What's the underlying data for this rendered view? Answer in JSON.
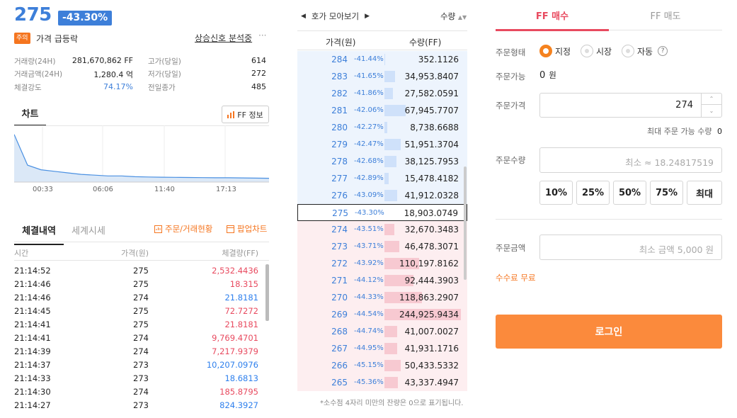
{
  "header": {
    "price": "275",
    "change": "-43.30%",
    "warn_badge": "주의",
    "warn_text": "가격 급등락",
    "analysis_link": "상승신호 분석중",
    "analysis_more": "···"
  },
  "stats": {
    "left": [
      {
        "label": "거래량(24H)",
        "value": "281,670,862 FF"
      },
      {
        "label": "거래금액(24H)",
        "value": "1,280.4 억"
      },
      {
        "label": "체결강도",
        "value": "74.17%"
      }
    ],
    "right": [
      {
        "label": "고가(당일)",
        "value": "614"
      },
      {
        "label": "저가(당일)",
        "value": "272"
      },
      {
        "label": "전일종가",
        "value": "485"
      }
    ]
  },
  "chart": {
    "tab": "차트",
    "info_button": "FF 정보",
    "time_labels": [
      "00:33",
      "06:06",
      "11:40",
      "17:13"
    ]
  },
  "chart_data": {
    "type": "area",
    "title": "",
    "xlabel": "",
    "ylabel": "",
    "x": [
      "00:33",
      "06:06",
      "11:40",
      "17:13"
    ],
    "values": [
      560,
      360,
      330,
      320,
      310,
      300,
      295,
      290,
      290,
      285,
      283,
      282,
      281,
      280,
      279,
      278,
      278,
      277,
      276,
      275
    ],
    "color": "#4a90e2"
  },
  "trades": {
    "tab_active": "체결내역",
    "tab_other": "세계시세",
    "link_orders": "주문/거래현황",
    "link_popup": "팝업차트",
    "columns": [
      "시간",
      "가격(원)",
      "체결량(FF)"
    ],
    "rows": [
      {
        "time": "21:14:52",
        "price": "275",
        "qty": "2,532.4436",
        "side": "buy"
      },
      {
        "time": "21:14:46",
        "price": "275",
        "qty": "18.315",
        "side": "buy"
      },
      {
        "time": "21:14:46",
        "price": "274",
        "qty": "21.8181",
        "side": "sell"
      },
      {
        "time": "21:14:45",
        "price": "275",
        "qty": "72.7272",
        "side": "buy"
      },
      {
        "time": "21:14:41",
        "price": "275",
        "qty": "21.8181",
        "side": "buy"
      },
      {
        "time": "21:14:41",
        "price": "274",
        "qty": "9,769.4701",
        "side": "buy"
      },
      {
        "time": "21:14:39",
        "price": "274",
        "qty": "7,217.9379",
        "side": "buy"
      },
      {
        "time": "21:14:37",
        "price": "273",
        "qty": "10,207.0976",
        "side": "sell"
      },
      {
        "time": "21:14:33",
        "price": "273",
        "qty": "18.6813",
        "side": "sell"
      },
      {
        "time": "21:14:30",
        "price": "274",
        "qty": "185.8795",
        "side": "buy"
      },
      {
        "time": "21:14:27",
        "price": "273",
        "qty": "824.3927",
        "side": "sell"
      }
    ]
  },
  "orderbook": {
    "top_left": "호가 모아보기",
    "top_right": "수량",
    "col_price": "가격(원)",
    "col_qty": "수량(FF)",
    "footnote": "*소수점 4자리 미만의 잔량은 0으로 표기됩니다.",
    "rows": [
      {
        "price": "284",
        "pct": "-41.44%",
        "qty": "352.1126",
        "side": "ask",
        "ratio": 0.01
      },
      {
        "price": "283",
        "pct": "-41.65%",
        "qty": "34,953.8407",
        "side": "ask",
        "ratio": 0.14
      },
      {
        "price": "282",
        "pct": "-41.86%",
        "qty": "27,582.0591",
        "side": "ask",
        "ratio": 0.11
      },
      {
        "price": "281",
        "pct": "-42.06%",
        "qty": "67,945.7707",
        "side": "ask",
        "ratio": 0.28
      },
      {
        "price": "280",
        "pct": "-42.27%",
        "qty": "8,738.6688",
        "side": "ask",
        "ratio": 0.04
      },
      {
        "price": "279",
        "pct": "-42.47%",
        "qty": "51,951.3704",
        "side": "ask",
        "ratio": 0.21
      },
      {
        "price": "278",
        "pct": "-42.68%",
        "qty": "38,125.7953",
        "side": "ask",
        "ratio": 0.16
      },
      {
        "price": "277",
        "pct": "-42.89%",
        "qty": "15,478.4182",
        "side": "ask",
        "ratio": 0.06
      },
      {
        "price": "276",
        "pct": "-43.09%",
        "qty": "41,912.0328",
        "side": "ask",
        "ratio": 0.17
      },
      {
        "price": "275",
        "pct": "-43.30%",
        "qty": "18,903.0749",
        "side": "current",
        "ratio": 0
      },
      {
        "price": "274",
        "pct": "-43.51%",
        "qty": "32,670.3483",
        "side": "bid",
        "ratio": 0.13
      },
      {
        "price": "273",
        "pct": "-43.71%",
        "qty": "46,478.3071",
        "side": "bid",
        "ratio": 0.19
      },
      {
        "price": "272",
        "pct": "-43.92%",
        "qty": "110,197.8162",
        "side": "bid",
        "ratio": 0.45
      },
      {
        "price": "271",
        "pct": "-44.12%",
        "qty": "92,444.3903",
        "side": "bid",
        "ratio": 0.38
      },
      {
        "price": "270",
        "pct": "-44.33%",
        "qty": "118,863.2907",
        "side": "bid",
        "ratio": 0.49
      },
      {
        "price": "269",
        "pct": "-44.54%",
        "qty": "244,925.9434",
        "side": "bid",
        "ratio": 1.0
      },
      {
        "price": "268",
        "pct": "-44.74%",
        "qty": "41,007.0027",
        "side": "bid",
        "ratio": 0.17
      },
      {
        "price": "267",
        "pct": "-44.95%",
        "qty": "41,931.1716",
        "side": "bid",
        "ratio": 0.17
      },
      {
        "price": "266",
        "pct": "-45.15%",
        "qty": "50,433.5332",
        "side": "bid",
        "ratio": 0.21
      },
      {
        "price": "265",
        "pct": "-45.36%",
        "qty": "43,337.4947",
        "side": "bid",
        "ratio": 0.18
      }
    ]
  },
  "order": {
    "buy_tab": "FF 매수",
    "sell_tab": "FF 매도",
    "type_label": "주문형태",
    "type_options": [
      "지정",
      "시장",
      "자동"
    ],
    "type_help": "?",
    "available_label": "주문가능",
    "available_value": "0",
    "available_unit": "원",
    "price_label": "주문가격",
    "price_value": "274",
    "max_qty_label": "최대 주문 가능 수량",
    "max_qty_value": "0",
    "qty_label": "주문수량",
    "qty_placeholder": "최소 ≈ 18.24817519",
    "pct_buttons": [
      "10%",
      "25%",
      "50%",
      "75%",
      "최대"
    ],
    "amount_label": "주문금액",
    "amount_placeholder": "최소 금액 5,000 원",
    "fee_text": "수수료 무료",
    "login_button": "로그인"
  }
}
